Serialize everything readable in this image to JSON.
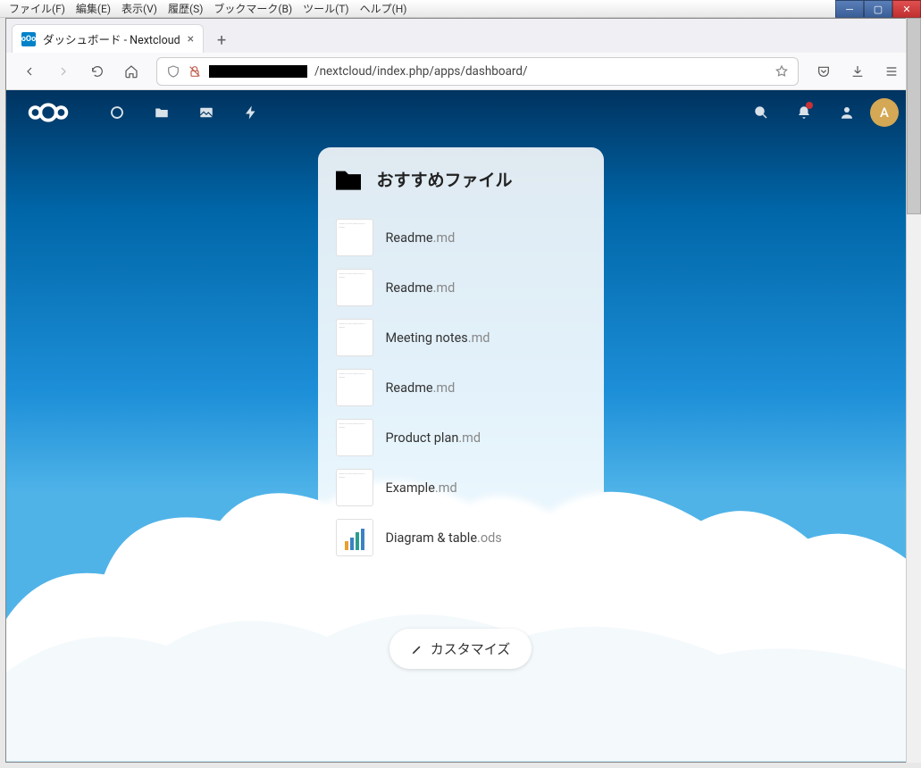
{
  "os_menu": [
    "ファイル(F)",
    "編集(E)",
    "表示(V)",
    "履歴(S)",
    "ブックマーク(B)",
    "ツール(T)",
    "ヘルプ(H)"
  ],
  "tab": {
    "title": "ダッシュボード - Nextcloud"
  },
  "url": {
    "path": "/nextcloud/index.php/apps/dashboard/"
  },
  "avatar_letter": "A",
  "widget": {
    "title": "おすすめファイル",
    "files": [
      {
        "name": "Readme",
        "ext": ".md"
      },
      {
        "name": "Readme",
        "ext": ".md"
      },
      {
        "name": "Meeting notes",
        "ext": ".md"
      },
      {
        "name": "Readme",
        "ext": ".md"
      },
      {
        "name": "Product plan",
        "ext": ".md"
      },
      {
        "name": "Example",
        "ext": ".md"
      },
      {
        "name": "Diagram & table",
        "ext": ".ods"
      }
    ]
  },
  "customize_label": "カスタマイズ"
}
